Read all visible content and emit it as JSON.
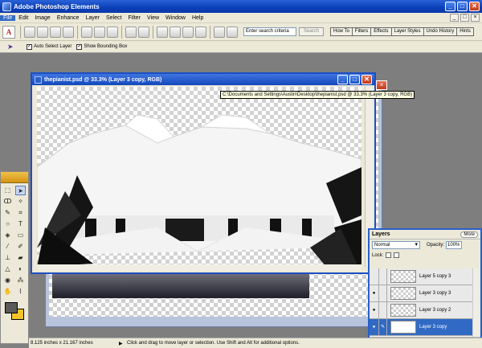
{
  "app": {
    "title": "Adobe Photoshop Elements"
  },
  "menu": [
    "File",
    "Edit",
    "Image",
    "Enhance",
    "Layer",
    "Select",
    "Filter",
    "View",
    "Window",
    "Help"
  ],
  "toolbar": {
    "search_placeholder": "Enter search criteria",
    "search_button": "Search",
    "palettes": [
      "How To",
      "Filters",
      "Effects",
      "Layer Styles",
      "Undo History",
      "Hints"
    ]
  },
  "options": {
    "auto_select_label": "Auto Select Layer",
    "bounding_box_label": "Show Bounding Box"
  },
  "document": {
    "title": "thepianist.psd @ 33.3% (Layer 3 copy, RGB)",
    "tooltip": "C:\\Documents and Settings\\Austin\\Desktop\\thepianist.psd @ 33.3% (Layer 3 copy, RGB)"
  },
  "layers": {
    "tab": "Layers",
    "more": "More",
    "blend_mode": "Normal",
    "opacity_label": "Opacity:",
    "opacity_value": "100%",
    "lock_label": "Lock:",
    "items": [
      "Layer 5 copy 3",
      "Layer 3 copy 3",
      "Layer 3 copy 2",
      "Layer 3 copy"
    ]
  },
  "status": {
    "doc_size": "8.125 inches x 21.167 inches",
    "hint": "Click and drag to move layer or selection. Use Shift and Alt for additional options."
  },
  "colors": {
    "title_bar": "#0a3fb8",
    "foreground": "#5a5a5a",
    "background": "#f4c42a",
    "selected_layer": "#316ac5"
  }
}
